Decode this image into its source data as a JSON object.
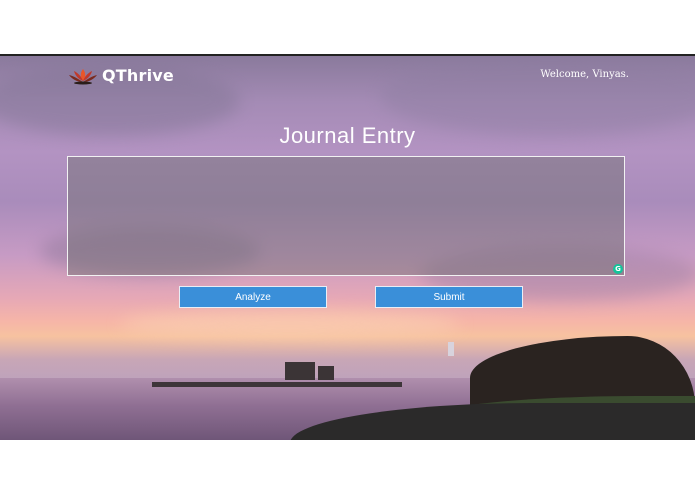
{
  "header": {
    "brand": "QThrive",
    "welcome": "Welcome, Vinyas.",
    "logo_icon": "lotus-icon"
  },
  "main": {
    "title": "Journal Entry",
    "journal_value": "",
    "grammarly_badge": "G",
    "analyze_label": "Analyze",
    "submit_label": "Submit"
  },
  "colors": {
    "button": "#3a8fd9",
    "text": "#ffffff",
    "box_border": "#f2f2f2"
  }
}
